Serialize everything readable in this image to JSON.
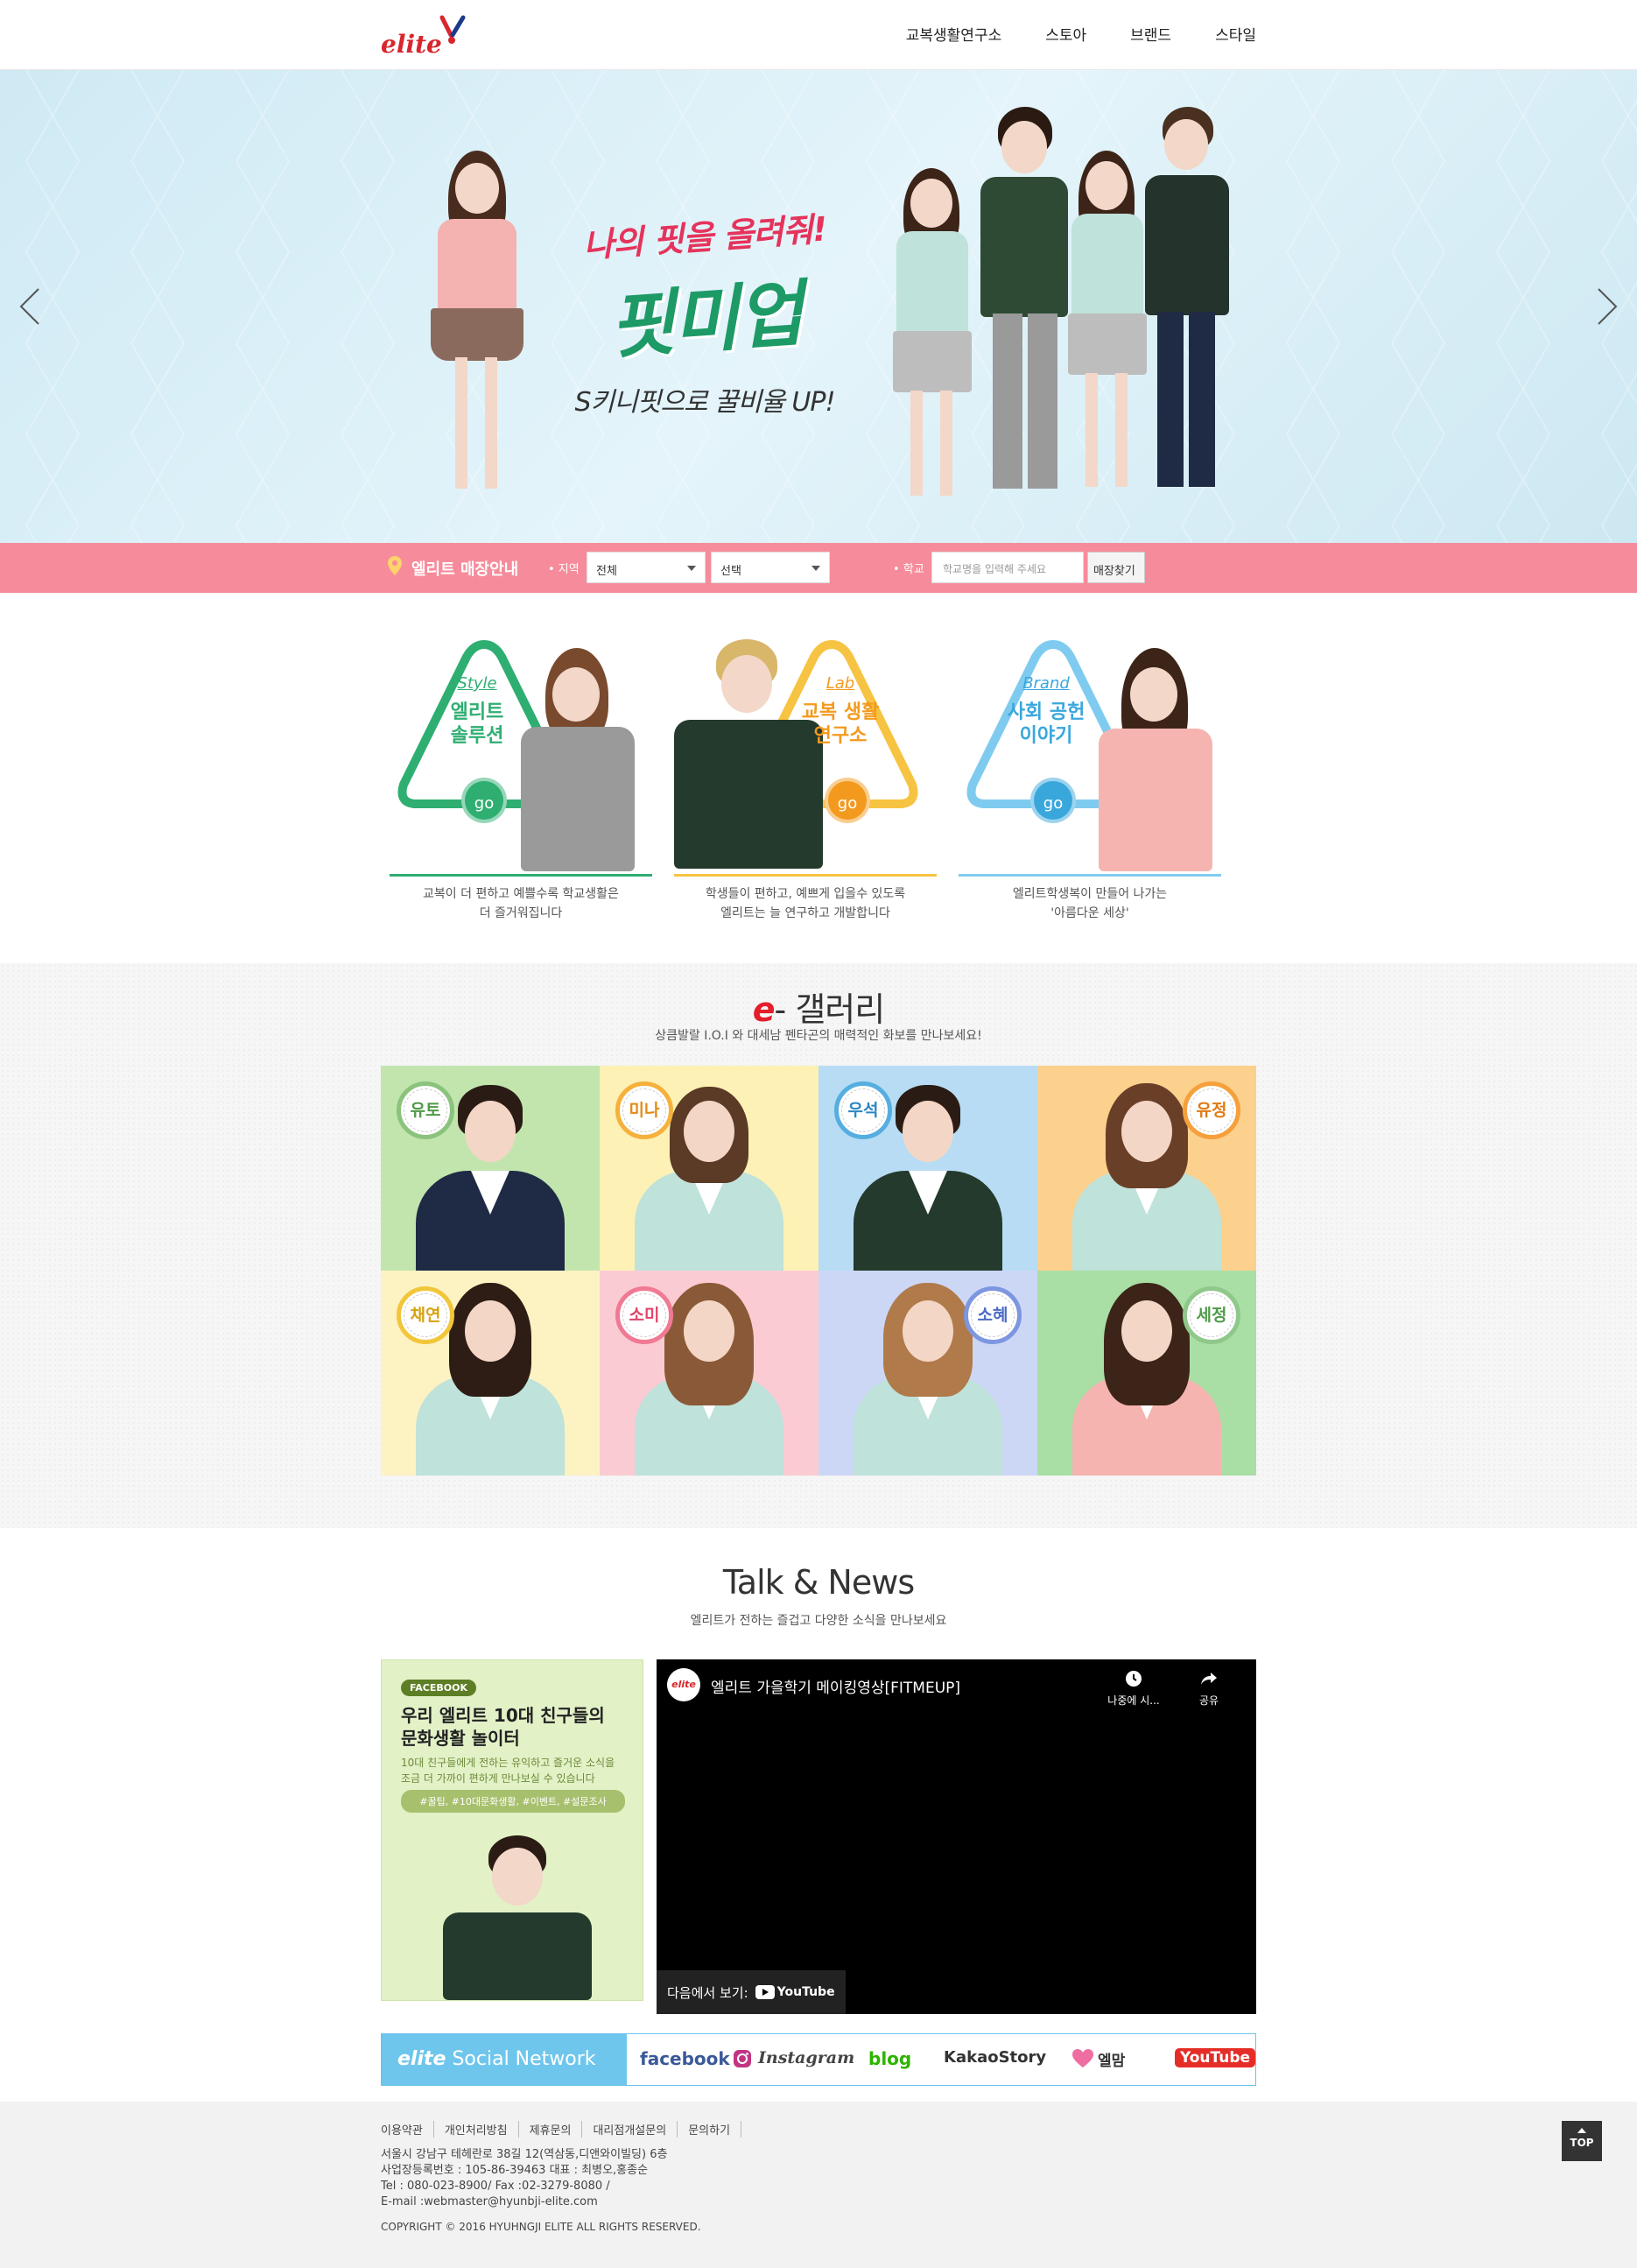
{
  "header": {
    "logo": "elite",
    "nav": [
      "교복생활연구소",
      "스토아",
      "브랜드",
      "스타일"
    ]
  },
  "hero": {
    "line1": "나의 핏을 올려줘!",
    "line2": "핏미업",
    "line3": "S키니핏으로 꿀비율 UP!"
  },
  "store": {
    "title": "엘리트 매장안내",
    "region_label": "• 지역",
    "region_value": "전체",
    "district_value": "선택",
    "school_label": "• 학교",
    "school_placeholder": "학교명을 입력해 주세요",
    "find_button": "매장찾기"
  },
  "cards": [
    {
      "sub": "Style",
      "title1": "엘리트",
      "title2": "솔루션",
      "go": "go",
      "desc1": "교복이 더 편하고 예쁠수록 학교생활은",
      "desc2": "더 즐거워집니다"
    },
    {
      "sub": "Lab",
      "title1": "교복 생활",
      "title2": "연구소",
      "go": "go",
      "desc1": "학생들이 편하고, 예쁘게 입을수 있도록",
      "desc2": "엘리트는 늘 연구하고 개발합니다"
    },
    {
      "sub": "Brand",
      "title1": "사회 공헌",
      "title2": "이야기",
      "go": "go",
      "desc1": "엘리트학생복이 만들어 나가는",
      "desc2": "'아름다운 세상'"
    }
  ],
  "gallery": {
    "title_e": "e",
    "title": "- 갤러리",
    "subtitle": "상큼발랄 I.O.I 와 대세남 펜타곤의 매력적인 화보를 만나보세요!",
    "members": [
      "유토",
      "미나",
      "우석",
      "유정",
      "채연",
      "소미",
      "소혜",
      "세정"
    ]
  },
  "talk": {
    "title": "Talk & News",
    "subtitle": "엘리트가 전하는 즐겁고 다양한 소식을 만나보세요",
    "fb_tag": "FACEBOOK",
    "fb_title1": "우리 엘리트 10대 친구들의",
    "fb_title2": "문화생활 놀이터",
    "fb_desc1": "10대 친구들에게 전하는 유익하고 즐거운 소식을",
    "fb_desc2": "조금 더 가까이 편하게 만나보실 수 있습니다",
    "fb_hashtags": "#꿀팁, #10대문화생활, #이벤트, #설문조사",
    "video_logo": "elite",
    "video_title": "엘리트 가을학기 메이킹영상[FITMEUP]",
    "watch_later": "나중에 시...",
    "share": "공유",
    "watch_on": "다음에서 보기:",
    "youtube": "YouTube"
  },
  "social": {
    "head_brand": "elite",
    "head_text": "Social Network",
    "items": [
      "facebook",
      "Instagram",
      "blog",
      "KakaoStory",
      "엘맘",
      "YouTube"
    ]
  },
  "footer": {
    "links": [
      "이용약관",
      "개인처리방침",
      "제휴문의",
      "대리점개설문의",
      "문의하기"
    ],
    "addr": "서울시 강남구 테헤란로 38길 12(역삼동,디앤와이빌딩) 6층",
    "biz": "사업장등록번호 : 105-86-39463 대표 : 최병오,홍종순",
    "tel": "Tel : 080-023-8900/ Fax :02-3279-8080 /",
    "email": "E-mail :webmaster@hyunbji-elite.com",
    "copyright": "COPYRIGHT © 2016 HYUHNGJI ELITE ALL RIGHTS RESERVED.",
    "top": "TOP"
  },
  "colors": {
    "brand_red": "#d8262d",
    "store_bar": "#f68c9b",
    "style_green": "#2fae72",
    "lab_orange": "#f39a1e",
    "brand_blue": "#3aa7dc",
    "social_blue": "#6fc6ec"
  }
}
